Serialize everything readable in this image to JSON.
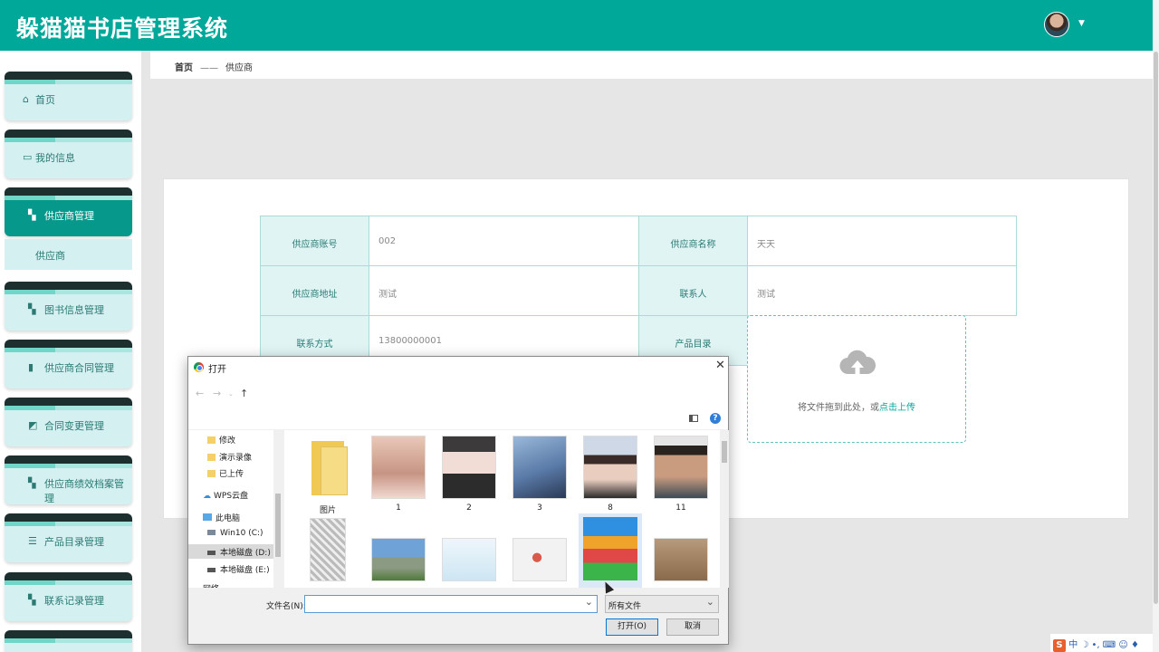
{
  "app": {
    "title": "躲猫猫书店管理系统"
  },
  "sidebar": {
    "items": [
      {
        "label": "首页",
        "icon": "home-icon"
      },
      {
        "label": "我的信息",
        "icon": "profile-card-icon"
      },
      {
        "label": "供应商管理",
        "icon": "grid-icon",
        "active": true
      },
      {
        "label": "图书信息管理",
        "icon": "grid-icon"
      },
      {
        "label": "供应商合同管理",
        "icon": "document-icon"
      },
      {
        "label": "合同变更管理",
        "icon": "ticket-icon"
      },
      {
        "label": "供应商绩效档案管理",
        "icon": "grid-icon"
      },
      {
        "label": "产品目录管理",
        "icon": "list-icon"
      },
      {
        "label": "联系记录管理",
        "icon": "grid-icon"
      }
    ],
    "sub_item": "供应商"
  },
  "breadcrumb": {
    "home": "首页",
    "sep": "——",
    "current": "供应商"
  },
  "form": {
    "account_label": "供应商账号",
    "account_value": "002",
    "name_label": "供应商名称",
    "name_value": "天天",
    "address_label": "供应商地址",
    "address_value": "测试",
    "contact_label": "联系人",
    "contact_value": "测试",
    "phone_label": "联系方式",
    "phone_value": "13800000001",
    "catalog_label": "产品目录"
  },
  "upload": {
    "hint": "将文件拖到此处，或",
    "link": "点击上传"
  },
  "dialog": {
    "title": "打开",
    "tree": [
      "修改",
      "演示录像",
      "已上传",
      "WPS云盘",
      "此电脑",
      "Win10 (C:)",
      "本地磁盘 (D:)",
      "本地磁盘 (E:)",
      "网络"
    ],
    "files": [
      {
        "name": "图片",
        "kind": "folder"
      },
      {
        "name": "1",
        "kind": "photo"
      },
      {
        "name": "2",
        "kind": "photo"
      },
      {
        "name": "3",
        "kind": "photo"
      },
      {
        "name": "8",
        "kind": "photo"
      },
      {
        "name": "11",
        "kind": "photo"
      },
      {
        "name": "",
        "kind": "photo"
      },
      {
        "name": "",
        "kind": "photo"
      },
      {
        "name": "",
        "kind": "photo"
      },
      {
        "name": "",
        "kind": "photo"
      },
      {
        "name": "",
        "kind": "archive"
      },
      {
        "name": "",
        "kind": "photo"
      }
    ],
    "filename_label": "文件名(N):",
    "filename_value": "",
    "filetype": "所有文件",
    "open_button": "打开(O)",
    "cancel_button": "取消"
  },
  "ime": {
    "label": "中"
  },
  "colors": {
    "brand": "#00a89a",
    "sidebar_item": "#d4f0f0",
    "active_item": "#06988a"
  }
}
